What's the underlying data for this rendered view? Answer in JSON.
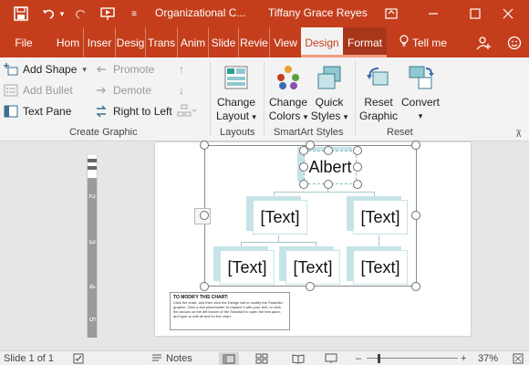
{
  "titlebar": {
    "save_icon": "save-icon",
    "undo_icon": "undo-icon",
    "redo_icon": "redo-icon",
    "present_icon": "present-from-beginning-icon",
    "customize_icon": "customize-quick-access-icon",
    "doc_title": "Organizational C...",
    "user_name": "Tiffany Grace Reyes",
    "ribbon_display_icon": "ribbon-display-options-icon",
    "minimize_icon": "minimize-icon",
    "maximize_icon": "maximize-icon",
    "close_icon": "close-icon"
  },
  "tabs": {
    "file": "File",
    "home": "Hom",
    "insert": "Inser",
    "design_main": "Desig",
    "transitions": "Trans",
    "animations": "Anim",
    "slideshow": "Slide",
    "review": "Revie",
    "view": "View",
    "design": "Design",
    "format": "Format",
    "tellme": "Tell me",
    "tellme_icon": "lightbulb-icon",
    "share_icon": "share-person-icon",
    "smiley_icon": "smiley-icon"
  },
  "ribbon": {
    "create_graphic": {
      "label": "Create Graphic",
      "add_shape": "Add Shape",
      "add_bullet": "Add Bullet",
      "text_pane": "Text Pane",
      "promote": "Promote",
      "demote": "Demote",
      "right_to_left": "Right to Left"
    },
    "layouts": {
      "label": "Layouts",
      "change_layout_line1": "Change",
      "change_layout_line2": "Layout"
    },
    "smartart_styles": {
      "label": "SmartArt Styles",
      "change_colors_line1": "Change",
      "change_colors_line2": "Colors",
      "quick_styles_line1": "Quick",
      "quick_styles_line2": "Styles"
    },
    "reset": {
      "label": "Reset",
      "reset_graphic_line1": "Reset",
      "reset_graphic_line2": "Graphic",
      "convert": "Convert"
    }
  },
  "ruler": {
    "marks": [
      "1",
      "2",
      "3",
      "4",
      "5"
    ]
  },
  "smartart": {
    "top_node": "Albert",
    "level2": [
      "[Text]",
      "[Text]"
    ],
    "level3": [
      "[Text]",
      "[Text]",
      "[Text]"
    ]
  },
  "note": {
    "title": "TO MODIFY THIS CHART:",
    "body": "Click the chart, and then click the Design tab to modify the SmartArt graphic. Click a text placeholder to replace it with your text, or click the arrows on the left border of the SmartArt to open the text pane, and type or edit all text for the chart."
  },
  "statusbar": {
    "slide_info": "Slide 1 of 1",
    "notes": "Notes",
    "zoom": "37%"
  },
  "colors": {
    "accent": "#c43e1c",
    "node_fill": "#c6e4e8"
  }
}
